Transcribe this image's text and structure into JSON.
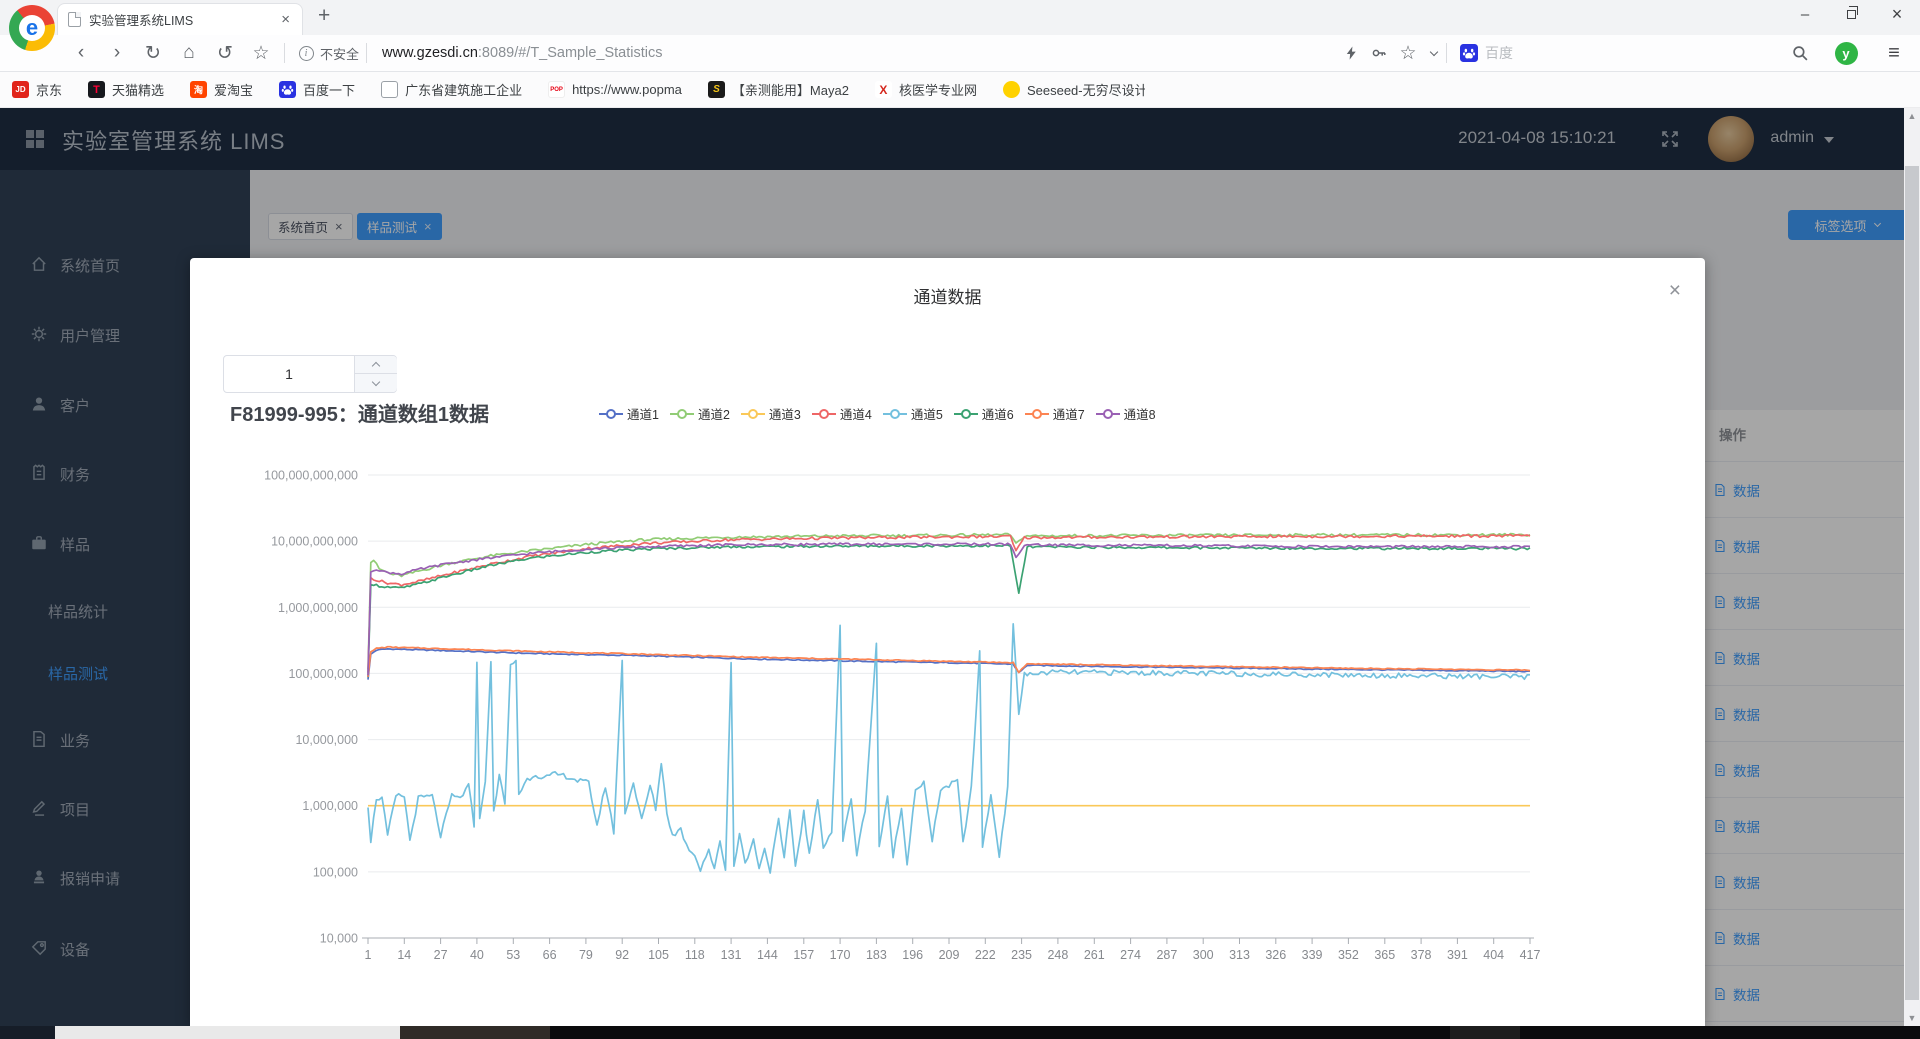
{
  "browser": {
    "tab_title": "实验管理系统LIMS",
    "security_label": "不安全",
    "url_host": "www.gzesdi.cn",
    "url_rest": ":8089/#/T_Sample_Statistics",
    "search_engine_label": "百度",
    "bookmarks": [
      {
        "label": "京东",
        "icon": "jd"
      },
      {
        "label": "天猫精选",
        "icon": "tmall"
      },
      {
        "label": "爱淘宝",
        "icon": "taobao"
      },
      {
        "label": "百度一下",
        "icon": "baidu"
      },
      {
        "label": "广东省建筑施工企业",
        "icon": "page"
      },
      {
        "label": "https://www.popma",
        "icon": "popmart"
      },
      {
        "label": "【亲测能用】Maya2",
        "icon": "maya"
      },
      {
        "label": "核医学专业网",
        "icon": "nucmed"
      },
      {
        "label": "Seeseed-无穷尽设计",
        "icon": "seeseed"
      }
    ]
  },
  "header": {
    "app_title": "实验室管理系统 LIMS",
    "timestamp": "2021-04-08 15:10:21",
    "username": "admin"
  },
  "sidebar": {
    "items": [
      {
        "label": "系统首页",
        "icon": "home",
        "sub": false,
        "active": false
      },
      {
        "label": "用户管理",
        "icon": "gear",
        "sub": false,
        "active": false
      },
      {
        "label": "客户",
        "icon": "user",
        "sub": false,
        "active": false
      },
      {
        "label": "财务",
        "icon": "finance",
        "sub": false,
        "active": false
      },
      {
        "label": "样品",
        "icon": "briefcase",
        "sub": false,
        "active": false
      },
      {
        "label": "样品统计",
        "icon": null,
        "sub": true,
        "active": false
      },
      {
        "label": "样品测试",
        "icon": null,
        "sub": true,
        "active": true
      },
      {
        "label": "业务",
        "icon": "doc",
        "sub": false,
        "active": false
      },
      {
        "label": "项目",
        "icon": "pen",
        "sub": false,
        "active": false
      },
      {
        "label": "报销申请",
        "icon": "person",
        "sub": false,
        "active": false
      },
      {
        "label": "设备",
        "icon": "device",
        "sub": false,
        "active": false
      }
    ]
  },
  "tabs": [
    {
      "label": "系统首页",
      "active": false
    },
    {
      "label": "样品测试",
      "active": true
    }
  ],
  "toolbar_button": {
    "label": "标签选项"
  },
  "background_table": {
    "action_header": "操作",
    "action_label": "数据",
    "visible_rows": 10
  },
  "modal": {
    "title": "通道数据",
    "array_input_value": "1",
    "chart_heading": "F81999-995：通道数组1数据"
  },
  "chart_data": {
    "type": "line",
    "title": "F81999-995：通道数组1数据",
    "x_axis": {
      "type": "category",
      "min": 1,
      "max": 417,
      "tick_labels": [
        1,
        14,
        27,
        40,
        53,
        66,
        79,
        92,
        105,
        118,
        131,
        144,
        157,
        170,
        183,
        196,
        209,
        222,
        235,
        248,
        261,
        274,
        287,
        300,
        313,
        326,
        339,
        352,
        365,
        378,
        391,
        404,
        417
      ]
    },
    "y_axis": {
      "type": "log",
      "min": 10000,
      "max": 100000000000,
      "tick_labels": [
        "100,000,000,000",
        "10,000,000,000",
        "1,000,000,000",
        "100,000,000",
        "10,000,000",
        "1,000,000",
        "100,000",
        "10,000"
      ]
    },
    "legend": [
      "通道1",
      "通道2",
      "通道3",
      "通道4",
      "通道5",
      "通道6",
      "通道7",
      "通道8"
    ],
    "legend_position": "top",
    "grid": true,
    "series": [
      {
        "name": "通道1",
        "color": "#5470c6",
        "noise": 0.008,
        "keypoints": [
          [
            1,
            80000000.0
          ],
          [
            2,
            195000000.0
          ],
          [
            4,
            225000000.0
          ],
          [
            8,
            235000000.0
          ],
          [
            15,
            230000000.0
          ],
          [
            30,
            220000000.0
          ],
          [
            60,
            200000000.0
          ],
          [
            100,
            185000000.0
          ],
          [
            140,
            165000000.0
          ],
          [
            180,
            152000000.0
          ],
          [
            210,
            145000000.0
          ],
          [
            232,
            138000000.0
          ],
          [
            234,
            102000000.0
          ],
          [
            237,
            133000000.0
          ],
          [
            260,
            128000000.0
          ],
          [
            300,
            122000000.0
          ],
          [
            350,
            115000000.0
          ],
          [
            417,
            107000000.0
          ]
        ]
      },
      {
        "name": "通道2",
        "color": "#91cc75",
        "noise": 0.02,
        "keypoints": [
          [
            1,
            120000000.0
          ],
          [
            2,
            4800000000.0
          ],
          [
            3,
            5200000000.0
          ],
          [
            5,
            3800000000.0
          ],
          [
            9,
            3200000000.0
          ],
          [
            13,
            3000000000.0
          ],
          [
            20,
            3600000000.0
          ],
          [
            30,
            4600000000.0
          ],
          [
            45,
            6000000000.0
          ],
          [
            60,
            7200000000.0
          ],
          [
            80,
            9000000000.0
          ],
          [
            100,
            10500000000.0
          ],
          [
            130,
            11500000000.0
          ],
          [
            170,
            12000000000.0
          ],
          [
            200,
            12200000000.0
          ],
          [
            231,
            12500000000.0
          ],
          [
            233,
            9000000000.0
          ],
          [
            236,
            12000000000.0
          ],
          [
            280,
            12200000000.0
          ],
          [
            340,
            12400000000.0
          ],
          [
            417,
            12500000000.0
          ]
        ]
      },
      {
        "name": "通道3",
        "color": "#fac858",
        "noise": 0,
        "keypoints": [
          [
            1,
            1000000.0
          ],
          [
            417,
            1000000.0
          ]
        ]
      },
      {
        "name": "通道4",
        "color": "#ee6666",
        "noise": 0.02,
        "keypoints": [
          [
            1,
            100000000.0
          ],
          [
            2,
            2800000000.0
          ],
          [
            5,
            2500000000.0
          ],
          [
            9,
            2300000000.0
          ],
          [
            13,
            2200000000.0
          ],
          [
            20,
            2500000000.0
          ],
          [
            30,
            3200000000.0
          ],
          [
            45,
            4500000000.0
          ],
          [
            60,
            6000000000.0
          ],
          [
            80,
            7800000000.0
          ],
          [
            100,
            9200000000.0
          ],
          [
            130,
            10500000000.0
          ],
          [
            170,
            11200000000.0
          ],
          [
            200,
            11500000000.0
          ],
          [
            231,
            11800000000.0
          ],
          [
            233,
            7000000000.0
          ],
          [
            236,
            11300000000.0
          ],
          [
            280,
            11600000000.0
          ],
          [
            340,
            11800000000.0
          ],
          [
            417,
            12000000000.0
          ]
        ]
      },
      {
        "name": "通道5",
        "color": "#73c0de",
        "noise": 0.04,
        "keypoints": [
          [
            1,
            1000000.0
          ],
          [
            2,
            300000.0
          ],
          [
            4,
            1300000.0
          ],
          [
            6,
            1300000.0
          ],
          [
            8,
            350000.0
          ],
          [
            11,
            1400000.0
          ],
          [
            14,
            1400000.0
          ],
          [
            16,
            300000.0
          ],
          [
            19,
            1300000.0
          ],
          [
            24,
            1400000.0
          ],
          [
            27,
            350000.0
          ],
          [
            31,
            1400000.0
          ],
          [
            34,
            1300000.0
          ],
          [
            37,
            2000000.0
          ],
          [
            39,
            500000.0
          ],
          [
            40,
            160000000.0
          ],
          [
            41,
            600000.0
          ],
          [
            43,
            2500000.0
          ],
          [
            45,
            140000000.0
          ],
          [
            46,
            800000.0
          ],
          [
            48,
            3000000.0
          ],
          [
            50,
            1000000.0
          ],
          [
            52,
            130000000.0
          ],
          [
            54,
            160000000.0
          ],
          [
            55,
            1500000.0
          ],
          [
            58,
            2500000.0
          ],
          [
            61,
            3000000.0
          ],
          [
            64,
            2600000.0
          ],
          [
            68,
            3000000.0
          ],
          [
            72,
            2800000.0
          ],
          [
            76,
            2400000.0
          ],
          [
            80,
            2200000.0
          ],
          [
            83,
            500000.0
          ],
          [
            86,
            2000000.0
          ],
          [
            89,
            400000.0
          ],
          [
            92,
            150000000.0
          ],
          [
            93,
            800000.0
          ],
          [
            96,
            2200000.0
          ],
          [
            99,
            600000.0
          ],
          [
            102,
            2000000.0
          ],
          [
            104,
            900000.0
          ],
          [
            106,
            4500000.0
          ],
          [
            108,
            800000.0
          ],
          [
            110,
            350000.0
          ],
          [
            113,
            450000.0
          ],
          [
            115,
            250000.0
          ],
          [
            118,
            180000.0
          ],
          [
            120,
            110000.0
          ],
          [
            123,
            220000.0
          ],
          [
            125,
            105000.0
          ],
          [
            127,
            300000.0
          ],
          [
            129,
            110000.0
          ],
          [
            131,
            150000000.0
          ],
          [
            132,
            120000.0
          ],
          [
            134,
            400000.0
          ],
          [
            136,
            130000.0
          ],
          [
            139,
            300000.0
          ],
          [
            141,
            120000.0
          ],
          [
            143,
            220000.0
          ],
          [
            145,
            105000.0
          ],
          [
            148,
            600000.0
          ],
          [
            150,
            150000.0
          ],
          [
            152,
            900000.0
          ],
          [
            154,
            120000.0
          ],
          [
            157,
            800000.0
          ],
          [
            159,
            180000.0
          ],
          [
            162,
            1200000.0
          ],
          [
            164,
            250000.0
          ],
          [
            167,
            400000.0
          ],
          [
            170,
            500000000.0
          ],
          [
            171,
            300000.0
          ],
          [
            174,
            1300000.0
          ],
          [
            176,
            180000.0
          ],
          [
            179,
            900000.0
          ],
          [
            183,
            280000000.0
          ],
          [
            184,
            250000.0
          ],
          [
            187,
            1300000.0
          ],
          [
            189,
            180000.0
          ],
          [
            192,
            900000.0
          ],
          [
            194,
            140000.0
          ],
          [
            197,
            1800000.0
          ],
          [
            200,
            2200000.0
          ],
          [
            203,
            280000.0
          ],
          [
            206,
            1800000.0
          ],
          [
            209,
            2000000.0
          ],
          [
            212,
            2400000.0
          ],
          [
            214,
            280000.0
          ],
          [
            217,
            1800000.0
          ],
          [
            220,
            200000000.0
          ],
          [
            221,
            250000.0
          ],
          [
            224,
            1400000.0
          ],
          [
            227,
            180000.0
          ],
          [
            230,
            1800000.0
          ],
          [
            232,
            600000000.0
          ],
          [
            234,
            25000000.0
          ],
          [
            236,
            95000000.0
          ],
          [
            245,
            104000000.0
          ],
          [
            270,
            103000000.0
          ],
          [
            300,
            100000000.0
          ],
          [
            340,
            96000000.0
          ],
          [
            380,
            92000000.0
          ],
          [
            417,
            88000000.0
          ]
        ]
      },
      {
        "name": "通道6",
        "color": "#3ba272",
        "noise": 0.018,
        "keypoints": [
          [
            1,
            85000000.0
          ],
          [
            2,
            2300000000.0
          ],
          [
            5,
            2100000000.0
          ],
          [
            9,
            2000000000.0
          ],
          [
            13,
            1950000000.0
          ],
          [
            20,
            2300000000.0
          ],
          [
            30,
            3000000000.0
          ],
          [
            45,
            4300000000.0
          ],
          [
            60,
            5600000000.0
          ],
          [
            80,
            6800000000.0
          ],
          [
            100,
            7600000000.0
          ],
          [
            130,
            8200000000.0
          ],
          [
            170,
            8400000000.0
          ],
          [
            200,
            8500000000.0
          ],
          [
            231,
            8500000000.0
          ],
          [
            234,
            1600000000.0
          ],
          [
            237,
            8200000000.0
          ],
          [
            280,
            8000000000.0
          ],
          [
            340,
            7800000000.0
          ],
          [
            417,
            7700000000.0
          ]
        ]
      },
      {
        "name": "通道7",
        "color": "#fc8452",
        "noise": 0.008,
        "keypoints": [
          [
            1,
            90000000.0
          ],
          [
            2,
            210000000.0
          ],
          [
            4,
            240000000.0
          ],
          [
            8,
            250000000.0
          ],
          [
            15,
            245000000.0
          ],
          [
            30,
            235000000.0
          ],
          [
            60,
            215000000.0
          ],
          [
            100,
            195000000.0
          ],
          [
            140,
            175000000.0
          ],
          [
            180,
            162000000.0
          ],
          [
            210,
            152000000.0
          ],
          [
            232,
            145000000.0
          ],
          [
            234,
            105000000.0
          ],
          [
            237,
            140000000.0
          ],
          [
            260,
            135000000.0
          ],
          [
            300,
            128000000.0
          ],
          [
            350,
            120000000.0
          ],
          [
            417,
            112000000.0
          ]
        ]
      },
      {
        "name": "通道8",
        "color": "#9a60b4",
        "noise": 0.018,
        "keypoints": [
          [
            1,
            90000000.0
          ],
          [
            2,
            3500000000.0
          ],
          [
            4,
            3800000000.0
          ],
          [
            7,
            3400000000.0
          ],
          [
            13,
            3200000000.0
          ],
          [
            20,
            3800000000.0
          ],
          [
            30,
            4600000000.0
          ],
          [
            45,
            5600000000.0
          ],
          [
            60,
            6600000000.0
          ],
          [
            80,
            7600000000.0
          ],
          [
            100,
            8200000000.0
          ],
          [
            130,
            8800000000.0
          ],
          [
            170,
            9000000000.0
          ],
          [
            200,
            9000000000.0
          ],
          [
            231,
            9000000000.0
          ],
          [
            233,
            5500000000.0
          ],
          [
            236,
            8800000000.0
          ],
          [
            280,
            8600000000.0
          ],
          [
            340,
            8300000000.0
          ],
          [
            417,
            8200000000.0
          ]
        ]
      }
    ]
  }
}
